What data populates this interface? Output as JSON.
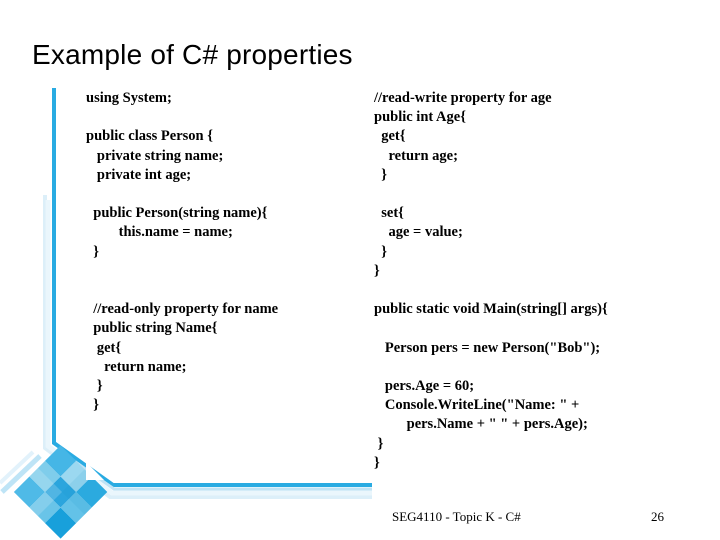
{
  "slide": {
    "title": "Example of C# properties",
    "accent_color": "#29ABE2",
    "accent_color_pale": "#CFEAF7",
    "accent_color_deep": "#0B8DC4",
    "background_color": "#FFFFFF",
    "text_color": "#000000"
  },
  "code_left": {
    "lines": [
      "using System;",
      "",
      "public class Person {",
      "   private string name;",
      "   private int age;",
      "",
      "  public Person(string name){",
      "         this.name = name;",
      "  }",
      "",
      "",
      "  //read-only property for name",
      "  public string Name{",
      "   get{",
      "     return name;",
      "   }",
      "  }"
    ]
  },
  "code_right": {
    "lines": [
      "//read-write property for age",
      "public int Age{",
      "  get{",
      "    return age;",
      "  }",
      "",
      "  set{",
      "    age = value;",
      "  }",
      "}",
      "",
      "public static void Main(string[] args){",
      "",
      "   Person pers = new Person(\"Bob\");",
      "",
      "   pers.Age = 60;",
      "   Console.WriteLine(\"Name: \" +",
      "         pers.Name + \" \" + pers.Age);",
      " }",
      "}"
    ]
  },
  "footer": {
    "course": "SEG4110 - Topic K - C#",
    "page_number": "26"
  },
  "decoration": {
    "vertical_rule": "cyan-vertical-rule",
    "horizontal_rule": "cyan-horizontal-rule",
    "emblem": "cyan-diamond-emblem"
  }
}
